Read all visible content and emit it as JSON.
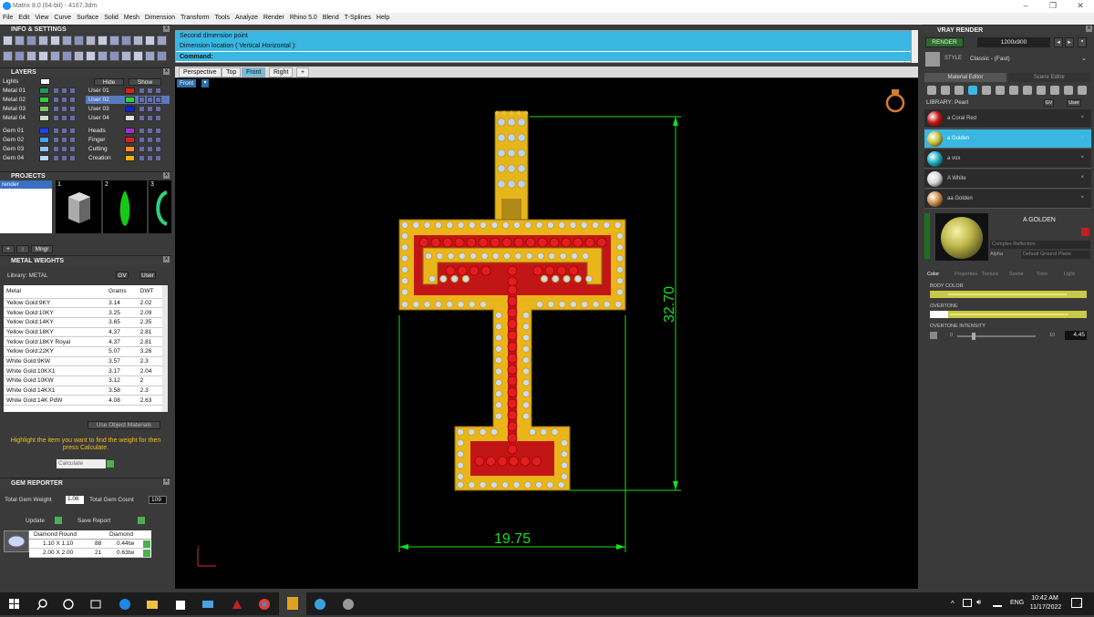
{
  "window": {
    "title": "Matrix 8.0 (64-bit) - 4167.3dm",
    "min": "–",
    "max": "❐",
    "close": "✕"
  },
  "menu": [
    "File",
    "Edit",
    "View",
    "Curve",
    "Surface",
    "Solid",
    "Mesh",
    "Dimension",
    "Transform",
    "Tools",
    "Analyze",
    "Render",
    "Rhino 5.0",
    "Blend",
    "T-Splines",
    "Help"
  ],
  "left": {
    "info_title": "INFO & SETTINGS",
    "layers_title": "LAYERS",
    "lights_label": "Lights",
    "hide_label": "Hide",
    "show_label": "Show",
    "layers_left": [
      {
        "name": "Metal 01",
        "color": "#1f9c52"
      },
      {
        "name": "Metal 02",
        "color": "#2fcf3f"
      },
      {
        "name": "Metal 03",
        "color": "#7ec86a"
      },
      {
        "name": "Metal 04",
        "color": "#c8e0c0"
      },
      {
        "name": "Gem 01",
        "color": "#2040ff"
      },
      {
        "name": "Gem 02",
        "color": "#4ba0ff"
      },
      {
        "name": "Gem 03",
        "color": "#8fc2ff"
      },
      {
        "name": "Gem 04",
        "color": "#b7d6ff"
      }
    ],
    "layers_right": [
      {
        "name": "User 01",
        "color": "#e21b1b"
      },
      {
        "name": "User 02",
        "color": "#30d030"
      },
      {
        "name": "User 03",
        "color": "#1020e0"
      },
      {
        "name": "User 04",
        "color": "#e0e0e0"
      },
      {
        "name": "Heads",
        "color": "#a030d0"
      },
      {
        "name": "Finger",
        "color": "#e02020"
      },
      {
        "name": "Cutting",
        "color": "#ff8c20"
      },
      {
        "name": "Creation",
        "color": "#ffb000"
      }
    ],
    "projects_title": "PROJECTS",
    "project_item": "render",
    "thumbs": [
      "1",
      "2",
      "3"
    ],
    "mngr_label": "Mngr",
    "metal_title": "METAL WEIGHTS",
    "library_label": "Library: METAL",
    "gv_label": "GV",
    "user_label": "User",
    "metal_headers": [
      "Metal",
      "Grams",
      "DWT"
    ],
    "metal_rows": [
      [
        "Yellow Gold:9KY",
        "3.14",
        "2.02"
      ],
      [
        "Yellow Gold:10KY",
        "3.25",
        "2.09"
      ],
      [
        "Yellow Gold:14KY",
        "3.65",
        "2.35"
      ],
      [
        "Yellow Gold:18KY",
        "4.37",
        "2.81"
      ],
      [
        "Yellow Gold:18KY Royal",
        "4.37",
        "2.81"
      ],
      [
        "Yellow Gold:22KY",
        "5.07",
        "3.26"
      ],
      [
        "White Gold:9KW",
        "3.57",
        "2.3"
      ],
      [
        "White Gold:10KX1",
        "3.17",
        "2.04"
      ],
      [
        "White Gold:10KW",
        "3.12",
        "2"
      ],
      [
        "White Gold:14KX1",
        "3.58",
        "2.3"
      ],
      [
        "White Gold:14K PdW",
        "4.08",
        "2.63"
      ]
    ],
    "use_object_materials": "Use Object Materials",
    "highlight_text": "Highlight the item you want to find the weight for then press Calculate.",
    "calculate_label": "Calculate",
    "gem_title": "GEM REPORTER",
    "total_gem_weight_label": "Total Gem Weight",
    "total_gem_weight": "1.06",
    "total_gem_count_label": "Total Gem Count",
    "total_gem_count": "109",
    "update_label": "Update",
    "save_report_label": "Save Report",
    "gem_headers": [
      "Diamond Round",
      "Diamond"
    ],
    "gem_rows": [
      [
        "1.10 X 1.10",
        "88",
        "0.44tw"
      ],
      [
        "2.00 X 2.00",
        "21",
        "0.63tw"
      ]
    ]
  },
  "command": {
    "line1": "Second dimension point",
    "line2": "Dimension location ( Vertical  Horizontal ):",
    "label": "Command:"
  },
  "viewtabs": [
    "Perspective",
    "Top",
    "Front",
    "Right",
    "+"
  ],
  "viewport": {
    "name": "Front",
    "dim_vertical": "32.70",
    "dim_horizontal": "19.75",
    "axis_label": "z"
  },
  "right": {
    "vray_title": "VRAY RENDER",
    "render_label": "RENDER",
    "resolution": "1200x900",
    "style_label": "STYLE",
    "style_value": "Classic - (Fast)",
    "tab_material": "Material Editor",
    "tab_scene": "Scene Editor",
    "library_label": "LIBRARY: Pearl",
    "gv_label": "GV",
    "user_label": "User",
    "materials": [
      {
        "name": "a Coral Red",
        "color": "#c81414"
      },
      {
        "name": "a Golden",
        "color": "#c9c03a"
      },
      {
        "name": "a vox",
        "color": "#18b0c0"
      },
      {
        "name": "A White",
        "color": "#d8d8d8"
      },
      {
        "name": "aa Golden",
        "color": "#d09050"
      }
    ],
    "selected_name": "A GOLDEN",
    "reflection_label": "Complex Reflection",
    "alpha_label": "Alpha",
    "ground_label": "Default Ground Plane",
    "sub_tabs": [
      "Color",
      "Properties",
      "Texture",
      "Scene",
      "Toon",
      "Light"
    ],
    "body_color_label": "BODY COLOR",
    "overtone_label": "OVERTONE",
    "overtone_intensity_label": "OVERTONE INTENSITY",
    "slider_min": "0",
    "slider_max": "10",
    "intensity_value": "4.45"
  },
  "taskbar": {
    "lang": "ENG",
    "time": "10:42 AM",
    "date": "11/17/2022",
    "notif": "2"
  }
}
